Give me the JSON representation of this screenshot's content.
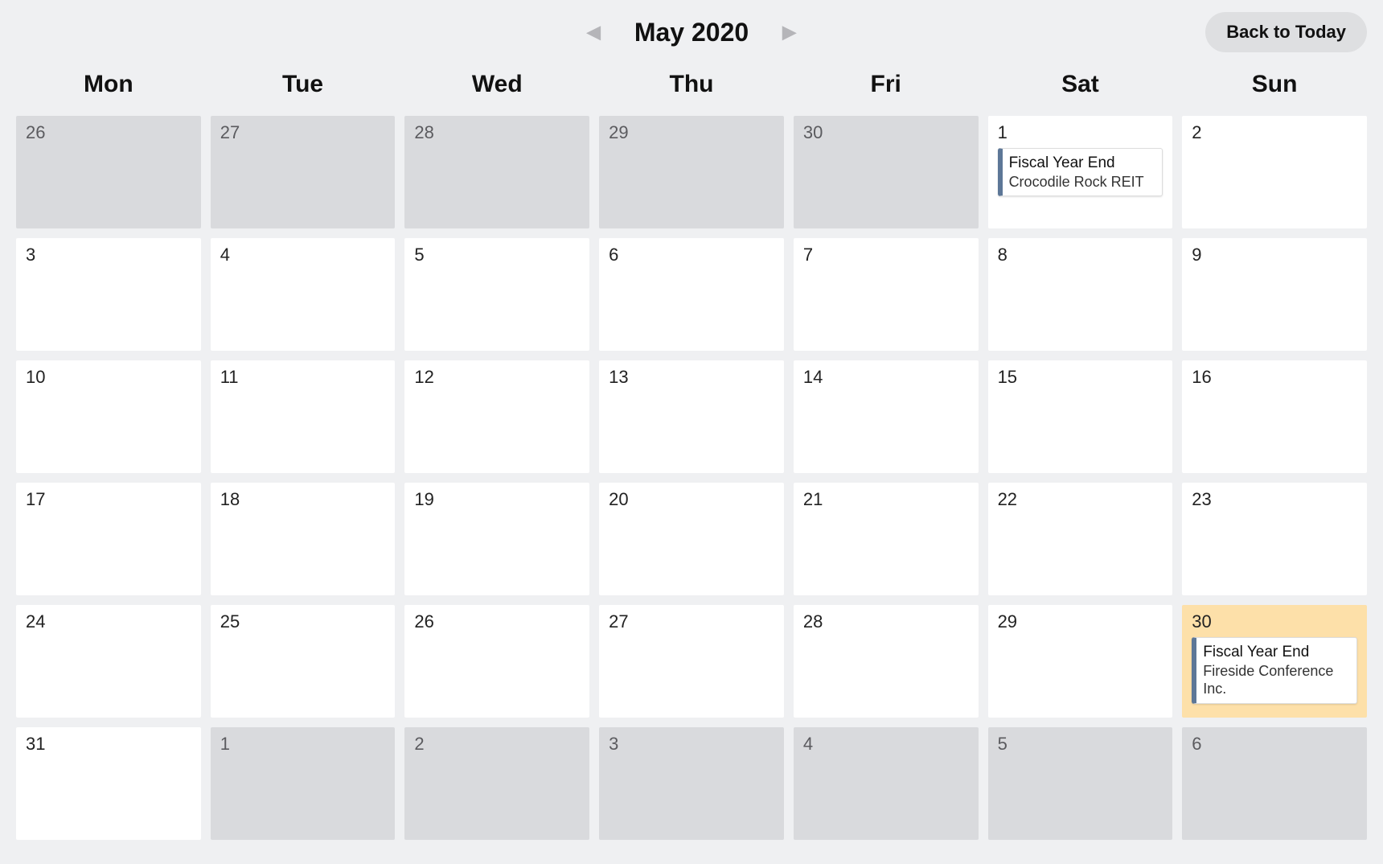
{
  "header": {
    "month_label": "May 2020",
    "back_to_today_label": "Back to Today"
  },
  "colors": {
    "event_accent": "#5d7797",
    "highlight_bg": "#fde0a9"
  },
  "dow": [
    "Mon",
    "Tue",
    "Wed",
    "Thu",
    "Fri",
    "Sat",
    "Sun"
  ],
  "cells": [
    {
      "day": "26",
      "outside": true
    },
    {
      "day": "27",
      "outside": true
    },
    {
      "day": "28",
      "outside": true
    },
    {
      "day": "29",
      "outside": true
    },
    {
      "day": "30",
      "outside": true
    },
    {
      "day": "1",
      "events": [
        {
          "title": "Fiscal Year End",
          "sub": "Crocodile Rock REIT"
        }
      ]
    },
    {
      "day": "2"
    },
    {
      "day": "3"
    },
    {
      "day": "4"
    },
    {
      "day": "5"
    },
    {
      "day": "6"
    },
    {
      "day": "7"
    },
    {
      "day": "8"
    },
    {
      "day": "9"
    },
    {
      "day": "10"
    },
    {
      "day": "11"
    },
    {
      "day": "12"
    },
    {
      "day": "13"
    },
    {
      "day": "14"
    },
    {
      "day": "15"
    },
    {
      "day": "16"
    },
    {
      "day": "17"
    },
    {
      "day": "18"
    },
    {
      "day": "19"
    },
    {
      "day": "20"
    },
    {
      "day": "21"
    },
    {
      "day": "22"
    },
    {
      "day": "23"
    },
    {
      "day": "24"
    },
    {
      "day": "25"
    },
    {
      "day": "26"
    },
    {
      "day": "27"
    },
    {
      "day": "28"
    },
    {
      "day": "29"
    },
    {
      "day": "30",
      "highlight": true,
      "events": [
        {
          "title": "Fiscal Year End",
          "sub": "Fireside Conference Inc."
        }
      ]
    },
    {
      "day": "31"
    },
    {
      "day": "1",
      "outside": true
    },
    {
      "day": "2",
      "outside": true
    },
    {
      "day": "3",
      "outside": true
    },
    {
      "day": "4",
      "outside": true
    },
    {
      "day": "5",
      "outside": true
    },
    {
      "day": "6",
      "outside": true
    }
  ]
}
